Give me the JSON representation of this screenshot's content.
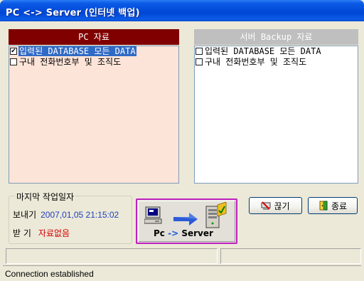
{
  "window": {
    "title": "PC <-> Server (인터넷 백업)"
  },
  "pc_panel": {
    "header": "PC 자료",
    "items": [
      {
        "label": "입력된 DATABASE 모든 DATA",
        "checked": true,
        "selected": true
      },
      {
        "label": "구내 전화번호부 및 조직도",
        "checked": false,
        "selected": false
      }
    ]
  },
  "server_panel": {
    "header": "서버 Backup 자료",
    "items": [
      {
        "label": "입력된 DATABASE 모든 DATA",
        "checked": false
      },
      {
        "label": "구내 전화번호부 및 조직도",
        "checked": false
      }
    ]
  },
  "last_work": {
    "legend": "마지막 작업일자",
    "sent_label": "보내기",
    "sent_value": "2007,01,05 21:15:02",
    "received_label": "받 기",
    "received_value": "자료없음"
  },
  "transfer_button": {
    "label_left": "Pc",
    "label_arrow": "->",
    "label_right": "Server"
  },
  "buttons": {
    "disconnect": "끊기",
    "exit": "종료"
  },
  "status": {
    "text": "Connection established"
  },
  "colors": {
    "titlebar": "#0046d5",
    "pc_header": "#800000",
    "server_header": "#bfbfbf",
    "pc_list_bg": "#fde4d8",
    "selection": "#316ac5",
    "sent_value": "#1f3fbf",
    "received_value": "#d40000",
    "transfer_border": "#c020c0"
  }
}
